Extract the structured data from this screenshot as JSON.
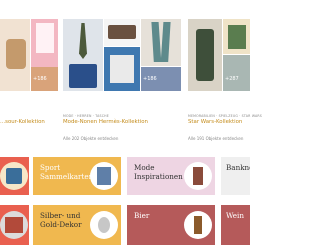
{
  "collections": [
    {
      "count": "+186",
      "categories": "",
      "title": "...sour-Kollektion",
      "more": ""
    },
    {
      "count": "+186",
      "categories": "MODE  ·  HERREN  ·  TASCHE",
      "title": "Mode-Nonen Hermès-Kollektion",
      "more": "Alle 202 Objekte entdecken"
    },
    {
      "count": "+287",
      "categories": "MEMORABILIEN  ·  SPIELZEUG  ·  STAR WARS",
      "title": "Star Wars-Kollektion",
      "more": "Alle 191 Objekte entdecken"
    }
  ],
  "category_tiles": [
    {
      "label_line1": "",
      "label_line2": "",
      "bg": "#e9604f"
    },
    {
      "label_line1": "Sport",
      "label_line2": "Sammelkarten",
      "bg": "#f0b84f"
    },
    {
      "label_line1": "Mode",
      "label_line2": "Inspirationen",
      "bg": "#eed5e3"
    },
    {
      "label_line1": "Bankno",
      "label_line2": "",
      "bg": "#efefef"
    },
    {
      "label_line1": "",
      "label_line2": "",
      "bg": "#e9604f"
    },
    {
      "label_line1": "Silber- und",
      "label_line2": "Gold-Dekor",
      "bg": "#f0b84f"
    },
    {
      "label_line1": "Bier",
      "label_line2": "",
      "bg": "#b55a5a"
    },
    {
      "label_line1": "Wein",
      "label_line2": "",
      "bg": "#b55a5a"
    }
  ]
}
